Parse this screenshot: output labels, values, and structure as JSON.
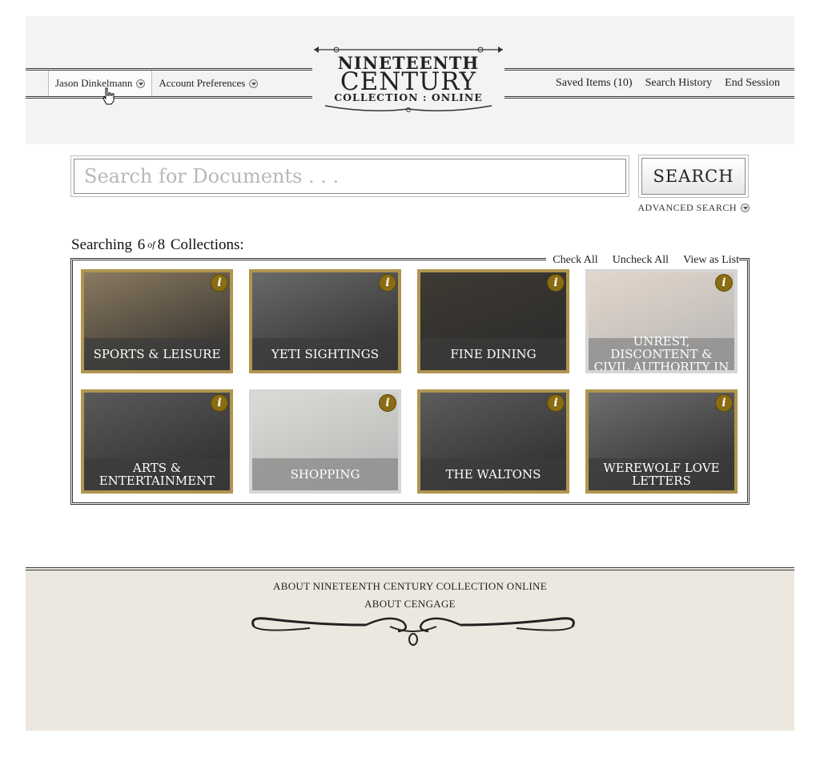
{
  "header": {
    "user_name": "Jason Dinkelmann",
    "account_preferences": "Account Preferences",
    "saved_items": "Saved Items (10)",
    "search_history": "Search History",
    "end_session": "End Session"
  },
  "logo": {
    "line1": "NINETEENTH",
    "line2": "CENTURY",
    "line3": "COLLECTION : ONLINE"
  },
  "search": {
    "placeholder": "Search for Documents . . .",
    "value": "",
    "button_label": "SEARCH",
    "advanced_label": "ADVANCED SEARCH"
  },
  "collections": {
    "searching_prefix": "Searching",
    "selected_count": "6",
    "of_label": "of",
    "total_count": "8",
    "searching_suffix": "Collections:",
    "check_all": "Check All",
    "uncheck_all": "Uncheck All",
    "view_as_list": "View as List",
    "tiles": [
      {
        "label": "SPORTS & LEISURE",
        "checked": true,
        "bg": "#8a7a60"
      },
      {
        "label": "YETI SIGHTINGS",
        "checked": true,
        "bg": "#6a6a6a"
      },
      {
        "label": "FINE DINING",
        "checked": true,
        "bg": "#3e3a34"
      },
      {
        "label": "UNREST, DISCONTENT & CIVIL AUTHORITY IN",
        "checked": false,
        "bg": "#b08a6a"
      },
      {
        "label": "ARTS & ENTERTAINMENT",
        "checked": true,
        "bg": "#5a5a5a"
      },
      {
        "label": "SHOPPING",
        "checked": false,
        "bg": "#9a9a8a"
      },
      {
        "label": "THE WALTONS",
        "checked": true,
        "bg": "#5c5c5c"
      },
      {
        "label": "WEREWOLF LOVE LETTERS",
        "checked": true,
        "bg": "#6e6e6e"
      }
    ],
    "info_glyph": "i"
  },
  "footer": {
    "about_collection": "ABOUT NINETEENTH CENTURY COLLECTION ONLINE",
    "about_cengage": "ABOUT CENGAGE"
  },
  "colors": {
    "tile_border": "#b09550",
    "info_badge": "#8a6d12",
    "footer_bg": "#ece8df"
  }
}
